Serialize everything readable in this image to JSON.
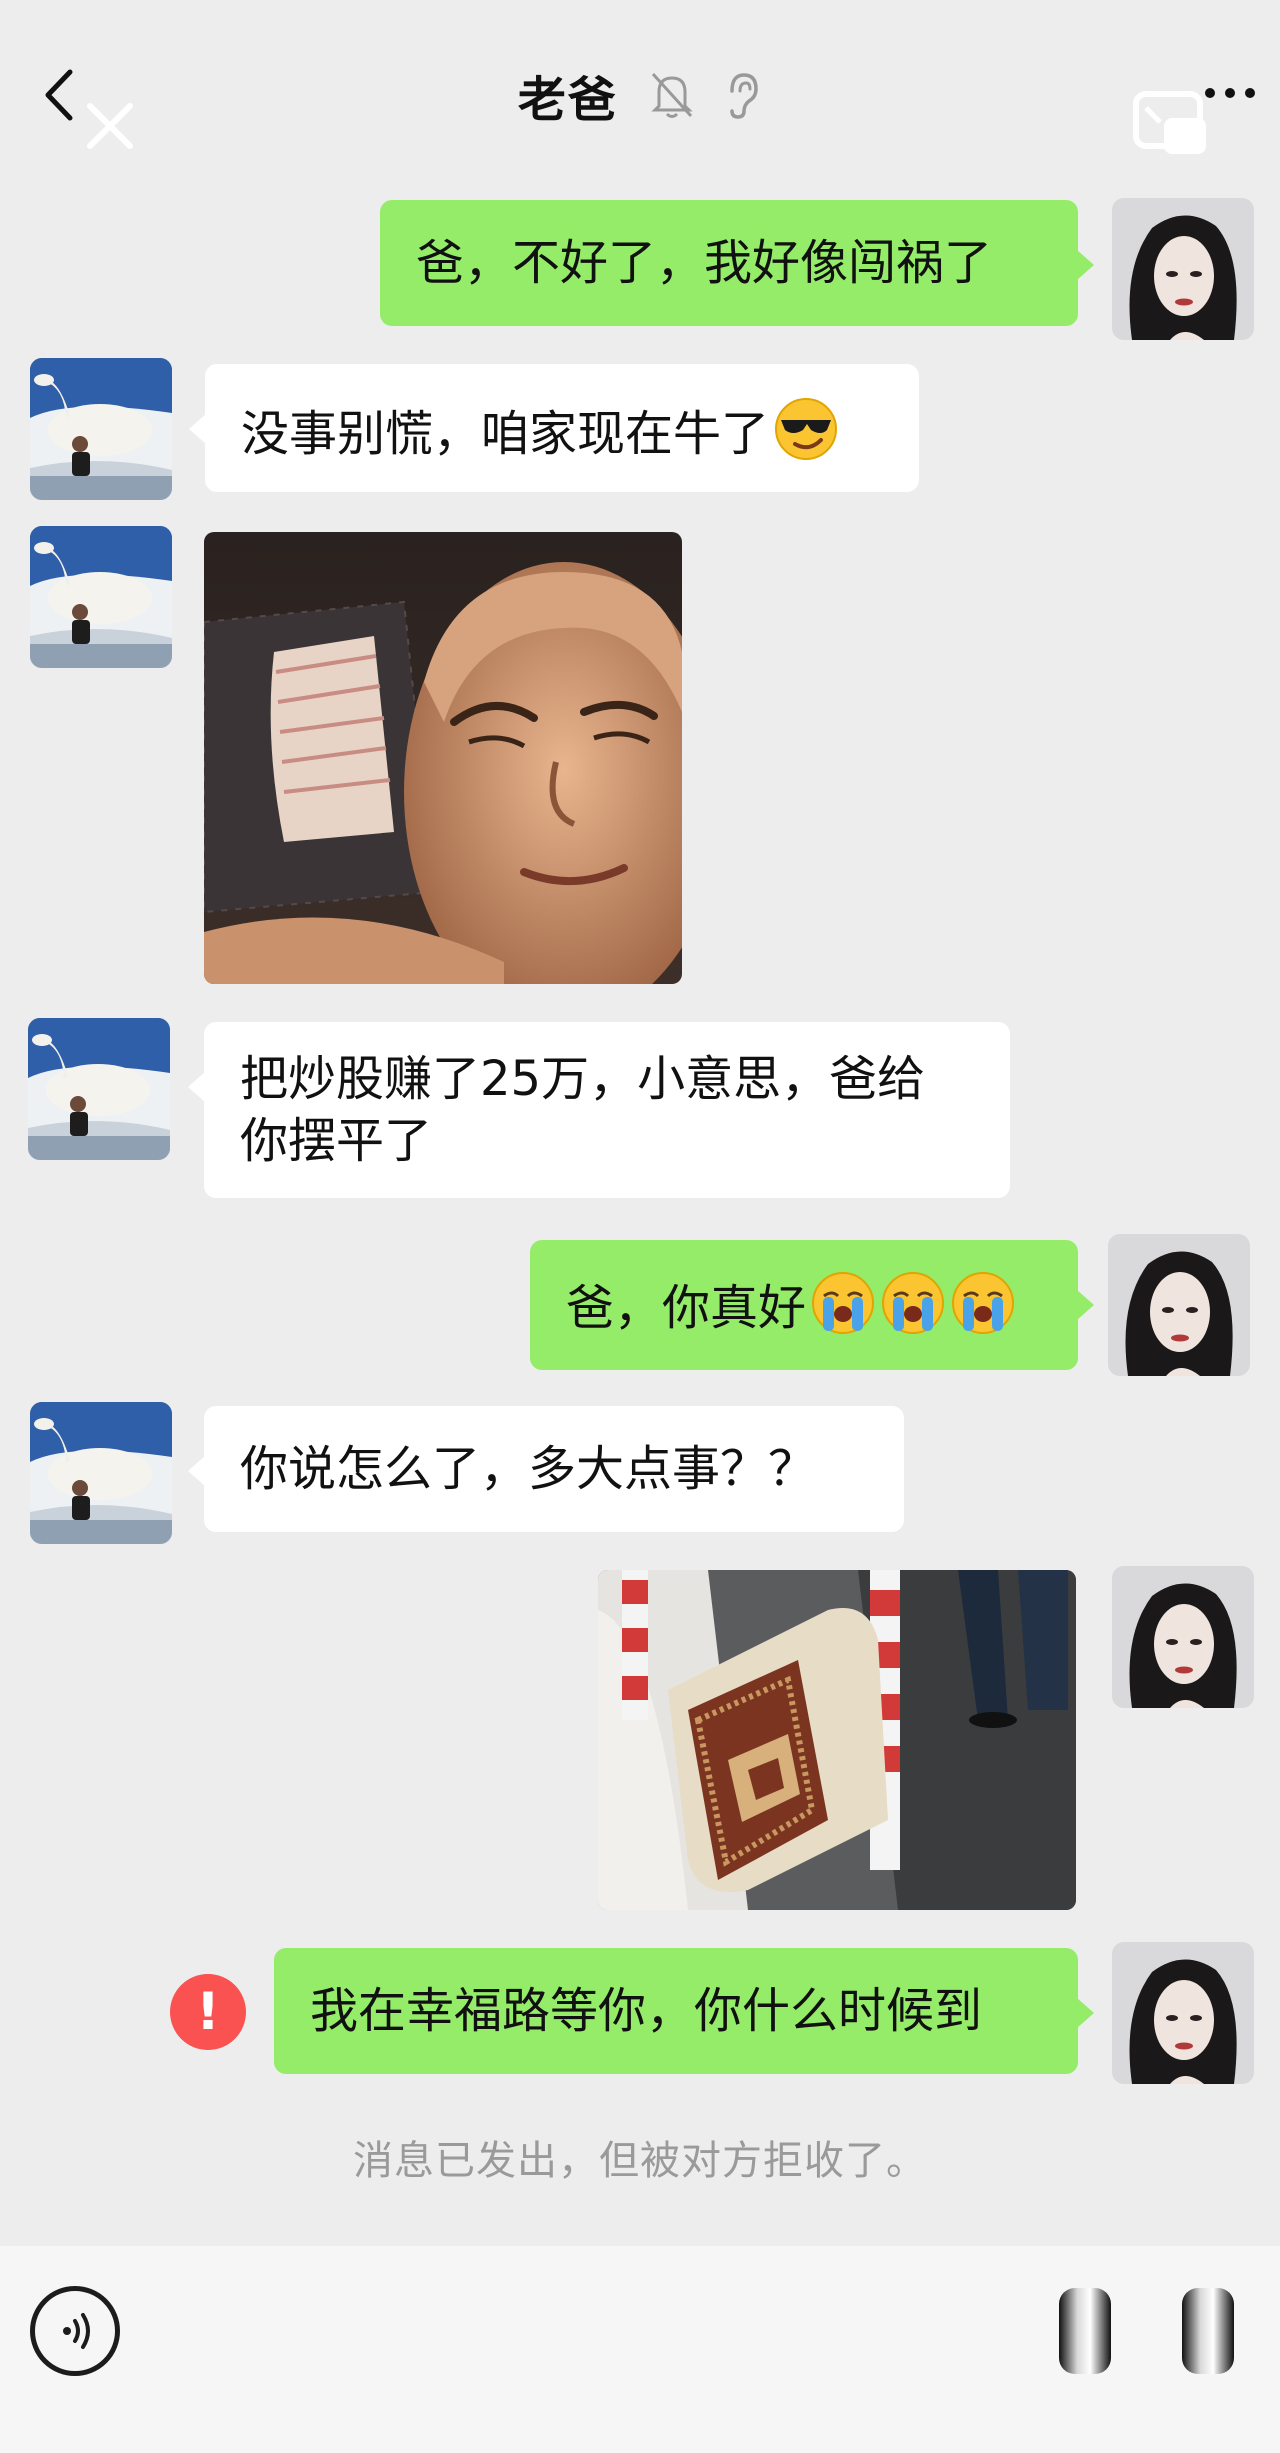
{
  "header": {
    "title": "老爸",
    "icons": [
      "back-arrow-icon",
      "close-icon",
      "mute-bell-icon",
      "ear-icon",
      "floating-window-icon",
      "more-icon"
    ]
  },
  "messages": [
    {
      "side": "right",
      "type": "text",
      "text": "爸，不好了，我好像闯祸了"
    },
    {
      "side": "left",
      "type": "text",
      "text": "没事别慌，咱家现在牛了",
      "emoji": "sunglasses-emoji"
    },
    {
      "side": "left",
      "type": "image",
      "image": "selfie-photo-with-cash-stack"
    },
    {
      "side": "left",
      "type": "text",
      "lines": [
        "把炒股赚了25万，小意思，爸给",
        "你摆平了"
      ]
    },
    {
      "side": "right",
      "type": "text",
      "text": "爸，你真好",
      "emoji": [
        "crying-emoji",
        "crying-emoji",
        "crying-emoji"
      ]
    },
    {
      "side": "left",
      "type": "text",
      "text": "你说怎么了，多大点事？？"
    },
    {
      "side": "right",
      "type": "image",
      "image": "street-photo-broken-milestone"
    },
    {
      "side": "right",
      "type": "text",
      "text": "我在幸福路等你，你什么时候到",
      "status": "failed"
    }
  ],
  "error_mark": "!",
  "system_notice": "消息已发出，但被对方拒收了。",
  "colors": {
    "background": "#ededed",
    "sent_bubble": "#95ec69",
    "received_bubble": "#ffffff",
    "error": "#fa5151",
    "notice_text": "#9a9a9a"
  },
  "bottom_bar": {
    "icons": [
      "voice-icon",
      "sticker-icon",
      "plus-icon"
    ]
  }
}
